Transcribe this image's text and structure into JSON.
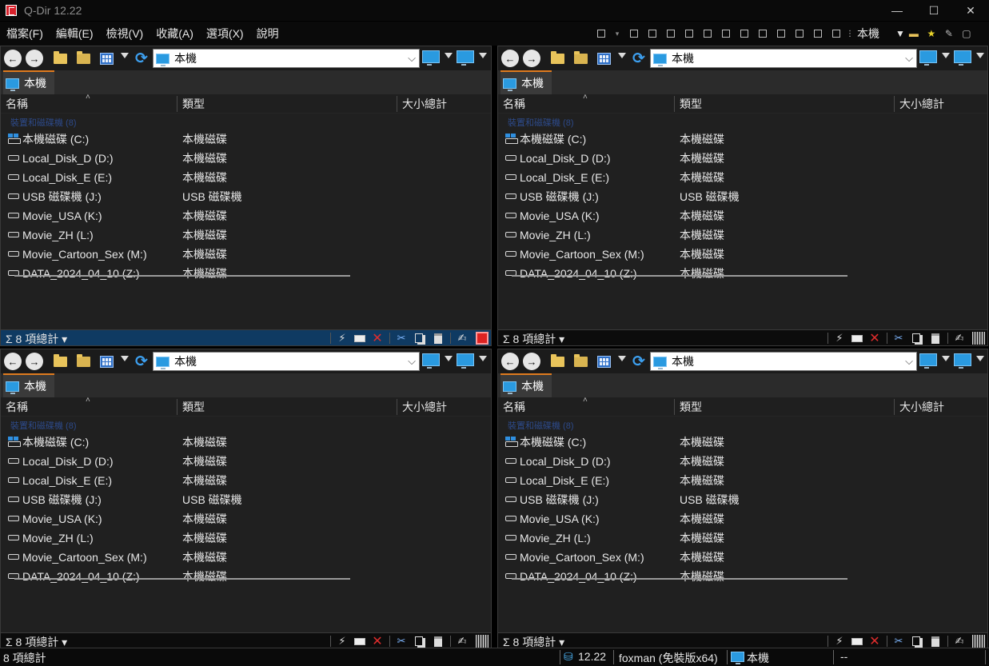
{
  "window": {
    "title": "Q-Dir 12.22",
    "controls": [
      "—",
      "☐",
      "✕"
    ]
  },
  "menu": {
    "items": [
      "檔案(F)",
      "編輯(E)",
      "檢視(V)",
      "收藏(A)",
      "選項(X)",
      "說明"
    ],
    "right_label": "本機"
  },
  "pane": {
    "address": "本機",
    "tab_label": "本機",
    "columns": {
      "name": "名稱",
      "type": "類型",
      "size": "大小總計"
    },
    "group_label": "裝置和磁碟機 (8)",
    "drives": [
      {
        "name": "本機磁碟 (C:)",
        "type": "本機磁碟",
        "icon": "system-drive-icon"
      },
      {
        "name": "Local_Disk_D (D:)",
        "type": "本機磁碟",
        "icon": "drive-icon"
      },
      {
        "name": "Local_Disk_E (E:)",
        "type": "本機磁碟",
        "icon": "drive-icon"
      },
      {
        "name": "USB 磁碟機 (J:)",
        "type": "USB 磁碟機",
        "icon": "drive-icon"
      },
      {
        "name": "Movie_USA (K:)",
        "type": "本機磁碟",
        "icon": "drive-icon"
      },
      {
        "name": "Movie_ZH (L:)",
        "type": "本機磁碟",
        "icon": "drive-icon"
      },
      {
        "name": "Movie_Cartoon_Sex (M:)",
        "type": "本機磁碟",
        "icon": "drive-icon"
      },
      {
        "name": "DATA_2024_04_10 (Z:)",
        "type": "本機磁碟",
        "icon": "drive-icon"
      }
    ],
    "status_count": "Σ 8 項總計 ▾"
  },
  "footer": {
    "count": "8 項總計",
    "version": "12.22",
    "user": "foxman (免裝版x64)",
    "location": "本機",
    "extra": "--"
  },
  "colors": {
    "accent_tab": "#e07b1e",
    "active_status": "#0f3a62",
    "background": "#202020"
  }
}
